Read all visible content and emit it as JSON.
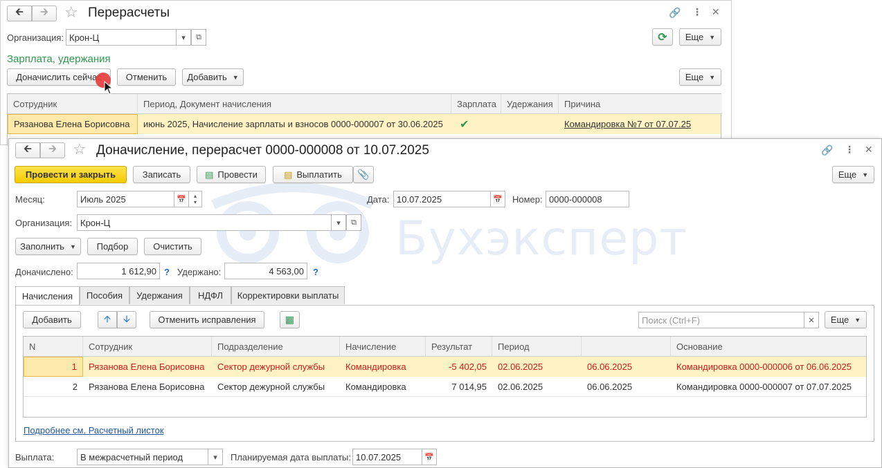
{
  "colors": {
    "accent_yellow": "#f5cc00",
    "section_green": "#2e9a4d",
    "link_blue": "#1f58a6",
    "correction_red": "#d11a1a",
    "highlight_row": "#fff3c4"
  },
  "back_window": {
    "title": "Перерасчеты",
    "org_label": "Организация:",
    "org_value": "Крон-Ц",
    "more_label": "Еще",
    "section_title": "Зарплата, удержания",
    "buttons": {
      "recalc_now": "Доначислить сейчас",
      "cancel": "Отменить",
      "add": "Добавить",
      "more": "Еще"
    },
    "table": {
      "headers": [
        "Сотрудник",
        "Период, Документ начисления",
        "Зарплата",
        "Удержания",
        "Причина"
      ],
      "row": {
        "employee": "Рязанова Елена Борисовна",
        "period_doc": "июнь 2025, Начисление зарплаты и взносов 0000-000007 от 30.06.2025",
        "salary_check": "✔",
        "deductions": "",
        "reason": "Командировка №7 от 07.07.25"
      }
    }
  },
  "front_window": {
    "title": "Доначисление, перерасчет 0000-000008 от 10.07.2025",
    "toolbar": {
      "post_close": "Провести и закрыть",
      "save": "Записать",
      "post": "Провести",
      "pay": "Выплатить",
      "more": "Еще"
    },
    "month_label": "Месяц:",
    "month_value": "Июль 2025",
    "date_label": "Дата:",
    "date_value": "10.07.2025",
    "number_label": "Номер:",
    "number_value": "0000-000008",
    "org_label": "Организация:",
    "org_value": "Крон-Ц",
    "fill_label": "Заполнить",
    "select_label": "Подбор",
    "clear_label": "Очистить",
    "accrued_label": "Доначислено:",
    "accrued_value": "1 612,90",
    "withheld_label": "Удержано:",
    "withheld_value": "4 563,00",
    "help_mark": "?",
    "tabs": [
      "Начисления",
      "Пособия",
      "Удержания",
      "НДФЛ",
      "Корректировки выплаты"
    ],
    "grid_toolbar": {
      "add": "Добавить",
      "cancel_fixes": "Отменить исправления",
      "search_placeholder": "Поиск (Ctrl+F)",
      "more": "Еще"
    },
    "grid": {
      "headers": [
        "N",
        "Сотрудник",
        "Подразделение",
        "Начисление",
        "Результат",
        "Период",
        "",
        "Основание"
      ],
      "rows": [
        {
          "n": "1",
          "employee": "Рязанова Елена Борисовна",
          "department": "Сектор дежурной службы",
          "accrual": "Командировка",
          "result": "-5 402,05",
          "period_from": "02.06.2025",
          "period_to": "06.06.2025",
          "basis": "Командировка 0000-000006 от 06.06.2025"
        },
        {
          "n": "2",
          "employee": "Рязанова Елена Борисовна",
          "department": "Сектор дежурной службы",
          "accrual": "Командировка",
          "result": "7 014,95",
          "period_from": "02.06.2025",
          "period_to": "06.06.2025",
          "basis": "Командировка 0000-000007 от 07.07.2025"
        }
      ]
    },
    "details_link": "Подробнее см. Расчетный листок",
    "payment_label": "Выплата:",
    "payment_value": "В межрасчетный период",
    "planned_date_label": "Планируемая дата выплаты:",
    "planned_date_value": "10.07.2025"
  },
  "watermark": "Бухэксперт"
}
